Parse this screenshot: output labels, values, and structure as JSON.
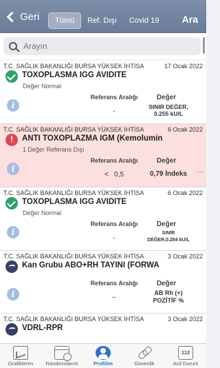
{
  "header": {
    "back_label": "Geri",
    "segments": [
      "Tümü",
      "Ref. Dışı",
      "Covid 19"
    ],
    "active_segment": "Tümü",
    "search_button": "Ara"
  },
  "search": {
    "placeholder": "Arayın"
  },
  "results": [
    {
      "source": "T.C. SAĞLIK BAKANLIĞI BURSA YÜKSEK İHTİSAS...",
      "date": "17 Ocak 2022",
      "status": "ok",
      "title": "TOXOPLASMA IGG AVIDITE",
      "subtitle": "Değer Normal",
      "ref_header": "Referans Aralığı",
      "value_header": "Değer",
      "ref_value": "-",
      "value_line1": "SINIR DEĞER,",
      "value_line2": "0.255 kU/L"
    },
    {
      "source": "T.C. SAĞLIK BAKANLIĞI BURSA YÜKSEK İHTİSAS...",
      "date": "6 Ocak 2022",
      "status": "warn",
      "title": "ANTI TOXOPLAZMA IGM (Kemolumin",
      "subtitle": "1 Değer Referans Dışı",
      "ref_header": "Referans Aralığı",
      "value_header": "Değer",
      "ref_value": "<   0,5",
      "value_line1": "0,79 İndeks",
      "value_line2": ""
    },
    {
      "source": "T.C. SAĞLIK BAKANLIĞI BURSA YÜKSEK İHTİSAS...",
      "date": "6 Ocak 2022",
      "status": "ok",
      "title": "TOXOPLASMA IGG AVIDITE",
      "subtitle": "Değer Normal",
      "ref_header": "Referans Aralığı",
      "value_header": "Değer",
      "ref_value": "-",
      "value_line1": "SINIR",
      "value_line2": "DEĞER,0.284 kU/L"
    },
    {
      "source": "T.C. SAĞLIK BAKANLIĞI BURSA YÜKSEK İHTİSAS...",
      "date": "3 Ocak 2022",
      "status": "wave",
      "title": "Kan Grubu ABO+RH TAYINI (FORWA",
      "subtitle": "",
      "ref_header": "Referans Aralığı",
      "value_header": "Değer",
      "ref_value": "--",
      "value_line1": "AB Rh (+)",
      "value_line2": "POZİTİF %"
    },
    {
      "source": "T.C. SAĞLIK BAKANLIĞI BURSA YÜKSEK İHTİSAS...",
      "date": "3 Ocak 2022",
      "status": "wave",
      "title": "VDRL-RPR",
      "subtitle": ""
    }
  ],
  "tabbar": [
    {
      "label": "Grafiklerim",
      "icon": "chart-icon"
    },
    {
      "label": "Randevularım",
      "icon": "calendar-icon"
    },
    {
      "label": "Profilim",
      "icon": "user-icon"
    },
    {
      "label": "Güvenlik",
      "icon": "link-icon"
    },
    {
      "label": "Acil Durum",
      "icon": "emergency-112-icon",
      "icon_text": "112"
    }
  ],
  "colors": {
    "header": "#7387a2",
    "ok": "#2f9e6b",
    "warn": "#d84b52",
    "alert_row": "#fbe0df",
    "accent": "#2f72c9"
  }
}
